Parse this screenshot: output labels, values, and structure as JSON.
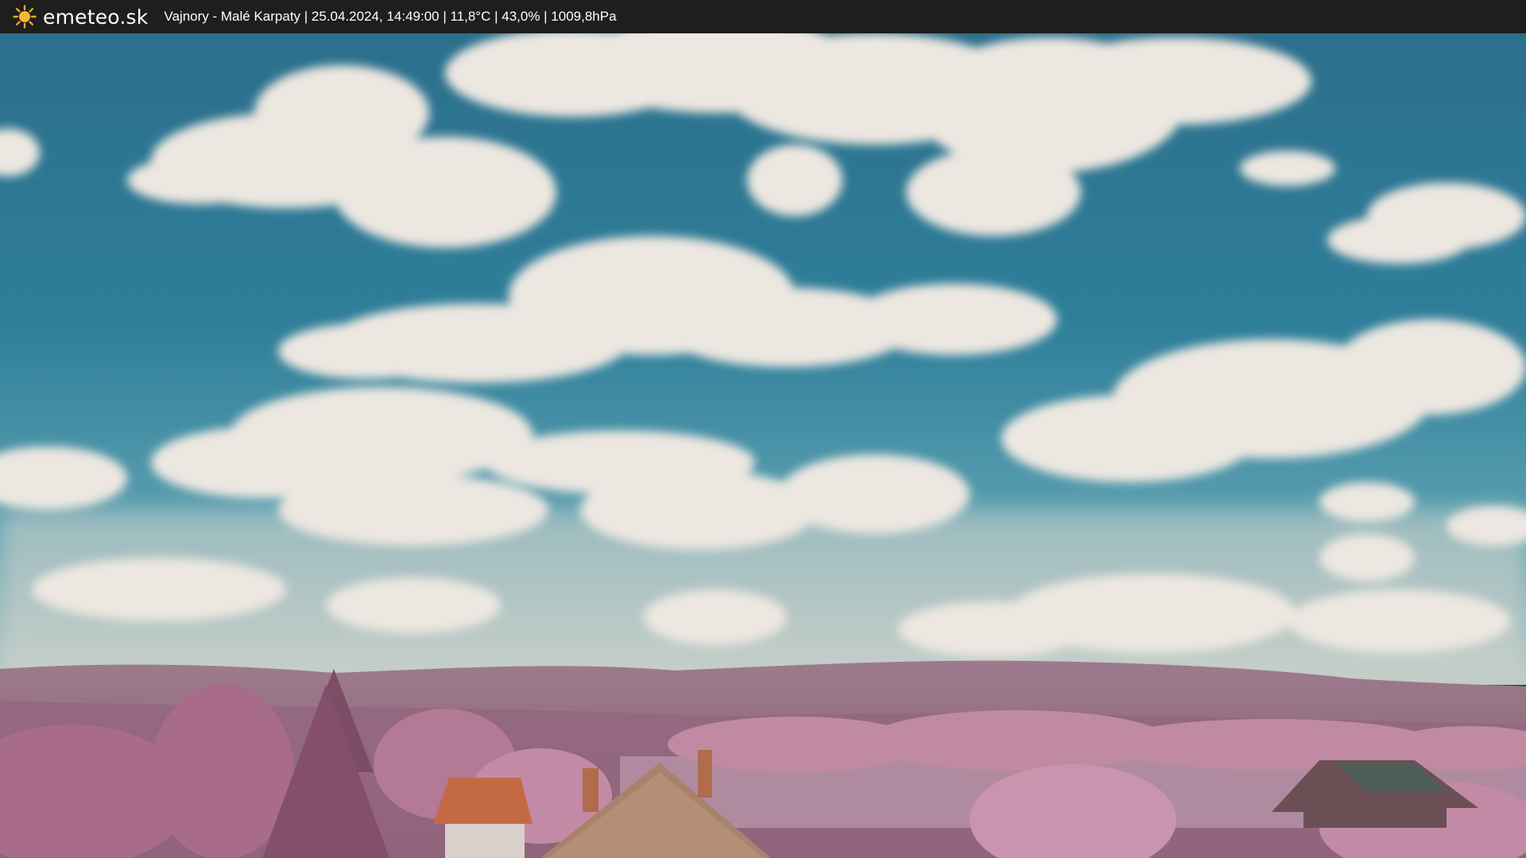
{
  "header": {
    "brand": "emeteo.sk",
    "caption": "Vajnory - Malé Karpaty | 25.04.2024, 14:49:00 | 11,8°C | 43,0% | 1009,8hPa",
    "logo_icon": "sun-icon",
    "accent_color": "#f5a623"
  },
  "scene": {
    "sky_color": "#2f7f9a",
    "cloud_color": "#e9e4dd",
    "hills_color": "#9a6e86",
    "foliage_color": "#c48fa8",
    "roof_color": "#c36a44"
  }
}
